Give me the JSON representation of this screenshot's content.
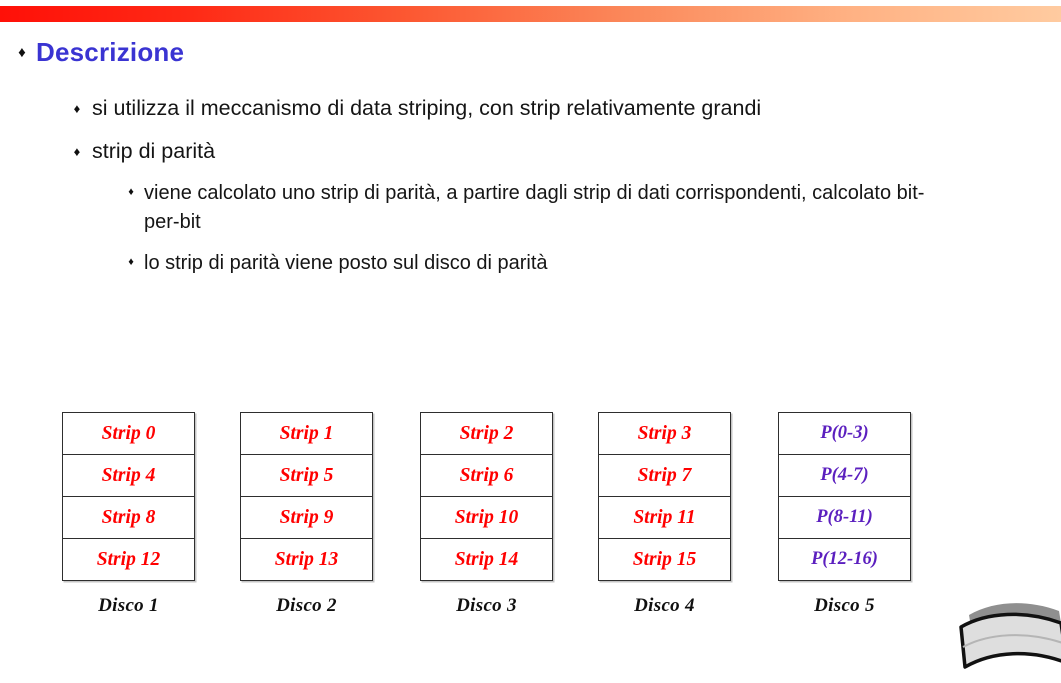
{
  "slide": {
    "top_bar": {
      "gradient_from": "#FF1008",
      "gradient_to": "#FFCBA0"
    },
    "heading": "Descrizione",
    "heading_color": "#3A34D2",
    "bullet_glyph": "♦",
    "bullets": [
      {
        "level": 2,
        "text": "si utilizza il meccanismo di data striping, con strip relativamente grandi"
      },
      {
        "level": 2,
        "text": "strip di parità"
      },
      {
        "level": 3,
        "text": "viene calcolato uno strip di parità, a partire dagli strip di dati corrispondenti, calcolato bit-per-bit"
      },
      {
        "level": 3,
        "text": "lo strip di parità viene posto sul disco di parità"
      }
    ]
  },
  "diagram": {
    "data_color": "#FF0000",
    "parity_color": "#5B1FBF",
    "columns": [
      {
        "caption": "Disco 1",
        "kind": "data",
        "cells": [
          "Strip 0",
          "Strip 4",
          "Strip 8",
          "Strip 12"
        ]
      },
      {
        "caption": "Disco 2",
        "kind": "data",
        "cells": [
          "Strip 1",
          "Strip 5",
          "Strip 9",
          "Strip 13"
        ]
      },
      {
        "caption": "Disco 3",
        "kind": "data",
        "cells": [
          "Strip 2",
          "Strip 6",
          "Strip 10",
          "Strip 14"
        ]
      },
      {
        "caption": "Disco 4",
        "kind": "data",
        "cells": [
          "Strip 3",
          "Strip 7",
          "Strip 11",
          "Strip 15"
        ]
      },
      {
        "caption": "Disco 5",
        "kind": "parity",
        "cells": [
          "P(0-3)",
          "P(4-7)",
          "P(8-11)",
          "P(12-16)"
        ]
      }
    ]
  }
}
